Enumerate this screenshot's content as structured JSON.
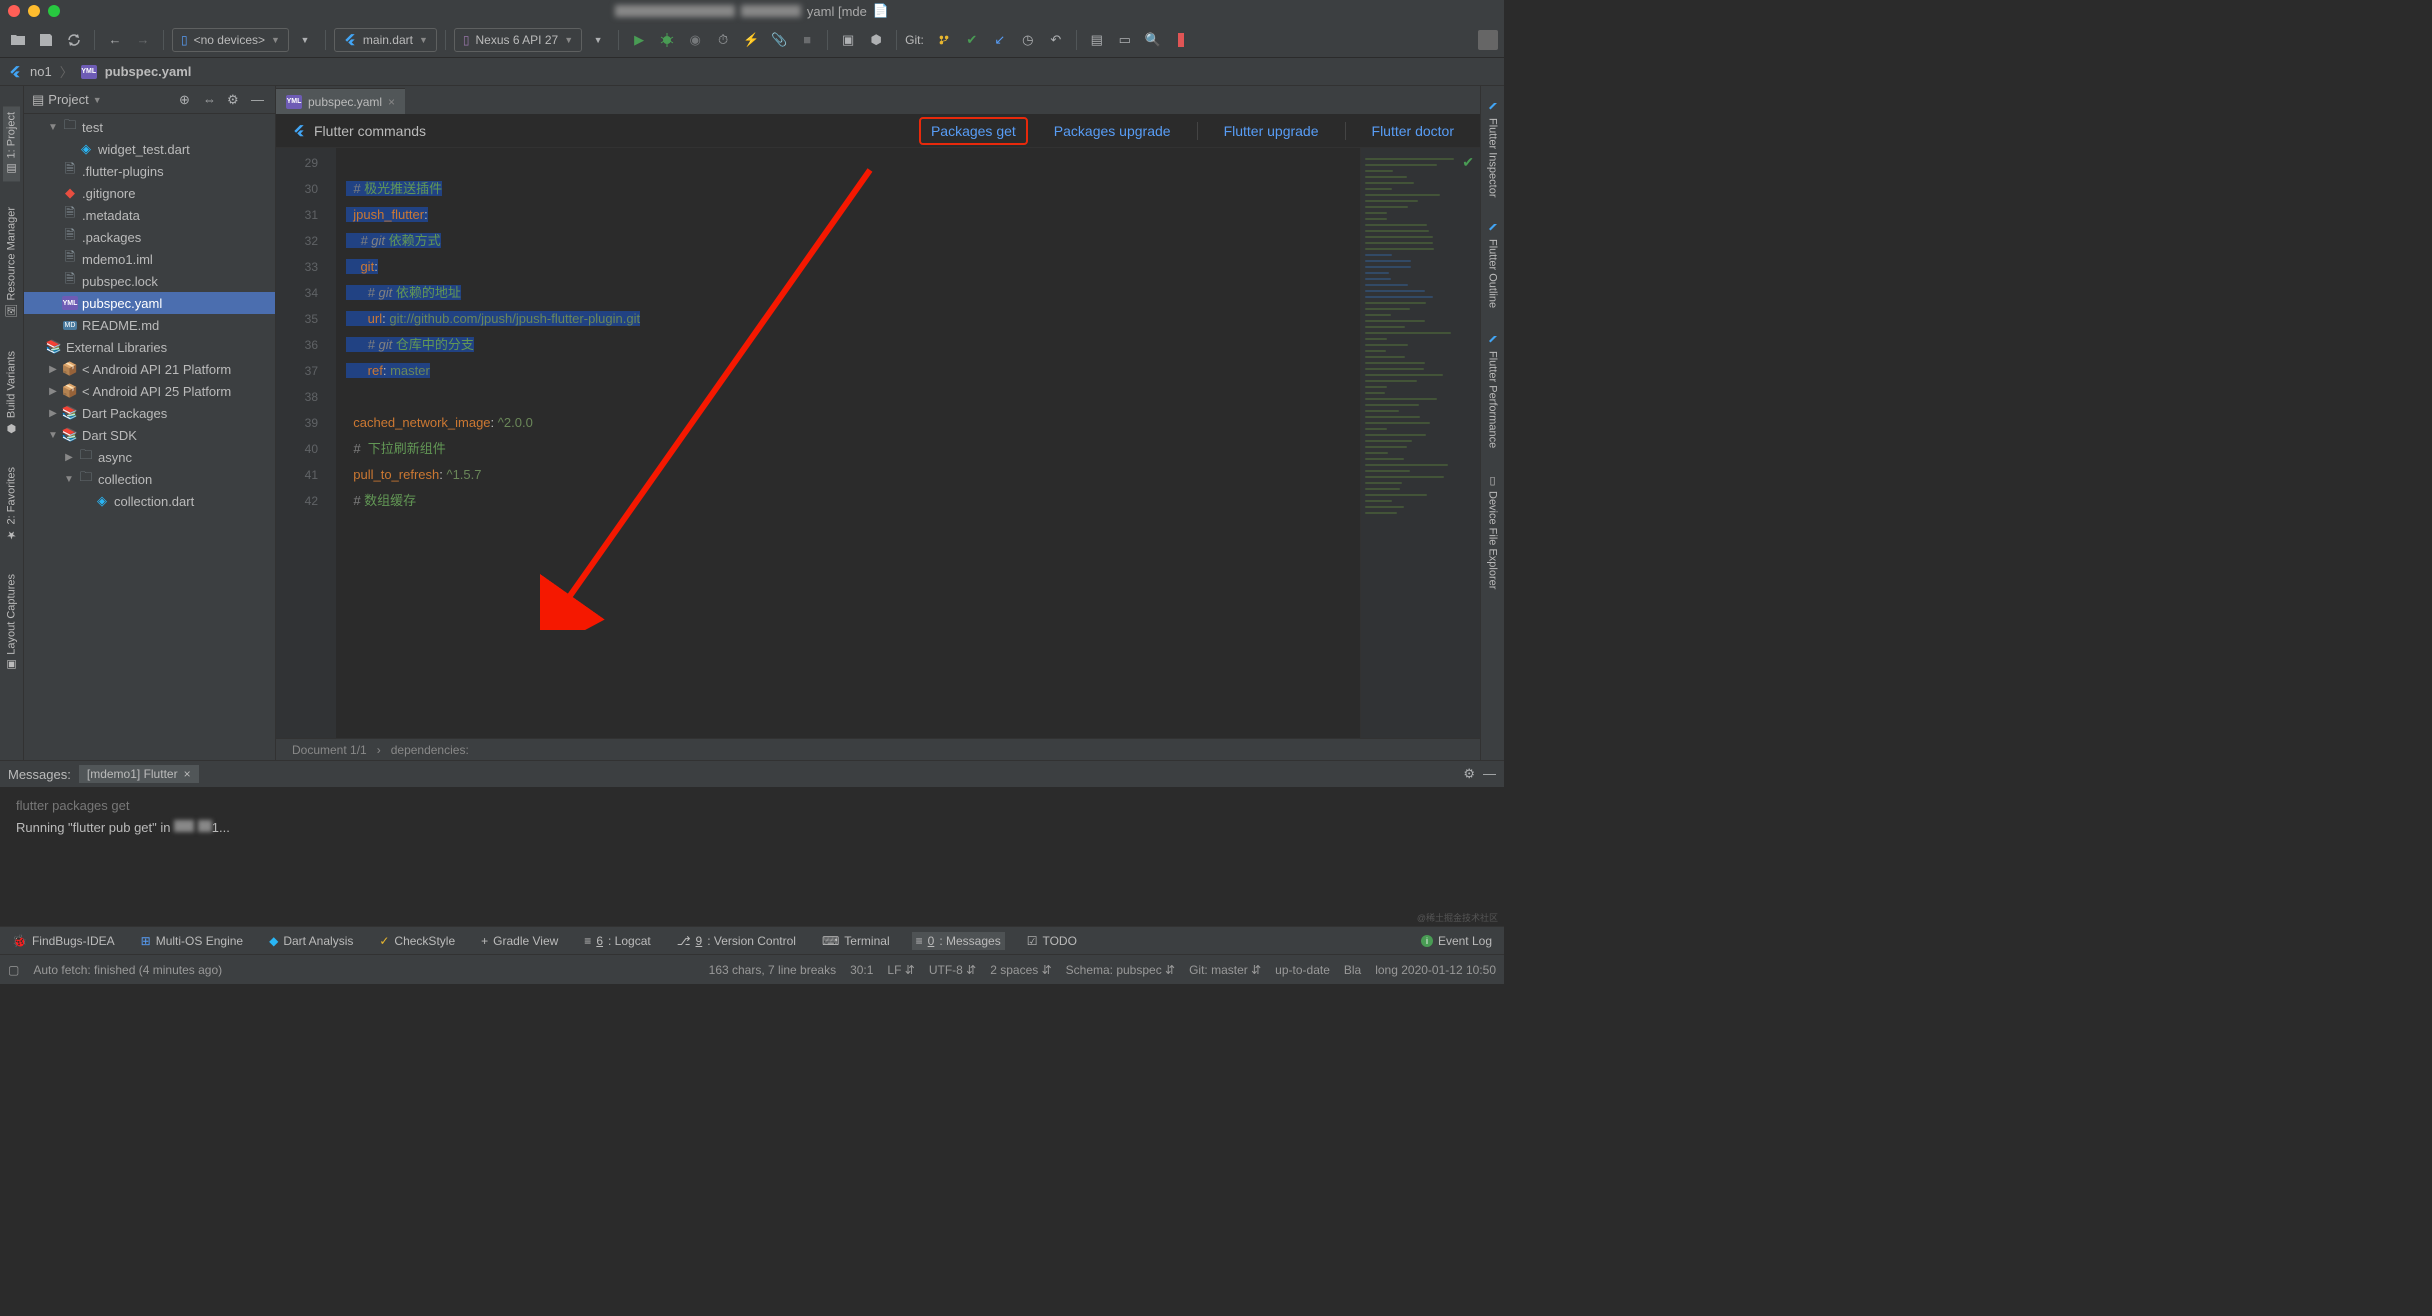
{
  "titlebar": {
    "suffix": "yaml [mde"
  },
  "toolbar": {
    "devices": "<no devices>",
    "runconfig": "main.dart",
    "emulator": "Nexus 6 API 27",
    "git_label": "Git:"
  },
  "breadcrumb": {
    "seg1": "no1",
    "seg2": "pubspec.yaml"
  },
  "left_tabs": {
    "project": "1: Project",
    "resource": "Resource Manager",
    "build": "Build Variants",
    "favorites": "2: Favorites",
    "captures": "Layout Captures"
  },
  "right_tabs": {
    "inspector": "Flutter Inspector",
    "outline": "Flutter Outline",
    "performance": "Flutter Performance",
    "device": "Device File Explorer"
  },
  "project": {
    "header": "Project",
    "tree": [
      {
        "d": 1,
        "exp": "▼",
        "icon": "folder",
        "label": "test"
      },
      {
        "d": 2,
        "exp": "",
        "icon": "dart",
        "label": "widget_test.dart"
      },
      {
        "d": 1,
        "exp": "",
        "icon": "file",
        "label": ".flutter-plugins"
      },
      {
        "d": 1,
        "exp": "",
        "icon": "gitign",
        "label": ".gitignore"
      },
      {
        "d": 1,
        "exp": "",
        "icon": "file",
        "label": ".metadata"
      },
      {
        "d": 1,
        "exp": "",
        "icon": "file",
        "label": ".packages"
      },
      {
        "d": 1,
        "exp": "",
        "icon": "file",
        "label": "mdemo1.iml"
      },
      {
        "d": 1,
        "exp": "",
        "icon": "file",
        "label": "pubspec.lock"
      },
      {
        "d": 1,
        "exp": "",
        "icon": "yaml",
        "label": "pubspec.yaml",
        "sel": true
      },
      {
        "d": 1,
        "exp": "",
        "icon": "md",
        "label": "README.md"
      },
      {
        "d": 0,
        "exp": "",
        "icon": "lib",
        "label": "External Libraries"
      },
      {
        "d": 1,
        "exp": "▶",
        "icon": "pkg",
        "label": "< Android API 21 Platform"
      },
      {
        "d": 1,
        "exp": "▶",
        "icon": "pkg",
        "label": "< Android API 25 Platform"
      },
      {
        "d": 1,
        "exp": "▶",
        "icon": "lib",
        "label": "Dart Packages"
      },
      {
        "d": 1,
        "exp": "▼",
        "icon": "lib",
        "label": "Dart SDK"
      },
      {
        "d": 2,
        "exp": "▶",
        "icon": "folder",
        "label": "async"
      },
      {
        "d": 2,
        "exp": "▼",
        "icon": "folder",
        "label": "collection"
      },
      {
        "d": 3,
        "exp": "",
        "icon": "dart",
        "label": "collection.dart"
      }
    ]
  },
  "editor": {
    "tab": "pubspec.yaml",
    "banner": {
      "title": "Flutter commands",
      "packages_get": "Packages get",
      "packages_upgrade": "Packages upgrade",
      "flutter_upgrade": "Flutter upgrade",
      "flutter_doctor": "Flutter doctor"
    },
    "gutter_start": 29,
    "lines": [
      {
        "n": 29,
        "html": ""
      },
      {
        "n": 30,
        "sel": true,
        "html": "<span class='cm'># </span><span class='cm-zh'>极光推送插件</span>"
      },
      {
        "n": 31,
        "sel": true,
        "html": "<span class='key'>jpush_flutter</span>:"
      },
      {
        "n": 32,
        "sel": true,
        "html": "  <span class='cm'># git </span><span class='cm-zh'>依赖方式</span>"
      },
      {
        "n": 33,
        "sel": true,
        "html": "  <span class='key'>git</span>:"
      },
      {
        "n": 34,
        "sel": true,
        "html": "    <span class='cm'># git </span><span class='cm-zh'>依赖的地址</span>"
      },
      {
        "n": 35,
        "sel": true,
        "html": "    <span class='key'>url</span>: <span class='str'>git://github.com/jpush/jpush-flutter-plugin.git</span>"
      },
      {
        "n": 36,
        "sel": true,
        "html": "    <span class='cm'># git </span><span class='cm-zh'>仓库中的分支</span>"
      },
      {
        "n": 37,
        "sel": true,
        "html": "    <span class='key'>ref</span>: <span class='str'>master</span>"
      },
      {
        "n": 38,
        "html": ""
      },
      {
        "n": 39,
        "html": "<span class='key'>cached_network_image</span>: <span class='str'>^2.0.0</span>"
      },
      {
        "n": 40,
        "html": "<span class='cm'>#  </span><span class='cm-zh'>下拉刷新组件</span>"
      },
      {
        "n": 41,
        "html": "<span class='key'>pull_to_refresh</span>: <span class='str'>^1.5.7</span>"
      },
      {
        "n": 42,
        "html": "<span class='cm'># </span><span class='cm-zh'>数组缓存</span>"
      }
    ],
    "status": {
      "doc": "Document 1/1",
      "path": "dependencies:"
    }
  },
  "messages": {
    "title": "Messages:",
    "tab": "[mdemo1] Flutter",
    "line1": "flutter packages get",
    "line2a": "Running \"flutter pub get\" in ",
    "line2b": "1..."
  },
  "bottom_tabs": {
    "findbugs": "FindBugs-IDEA",
    "multios": "Multi-OS Engine",
    "dart": "Dart Analysis",
    "checkstyle": "CheckStyle",
    "gradle": "Gradle View",
    "logcat_num": "6",
    "logcat": ": Logcat",
    "vcs_num": "9",
    "vcs": ": Version Control",
    "terminal": "Terminal",
    "messages_num": "0",
    "messages": ": Messages",
    "todo": "TODO",
    "eventlog": "Event Log"
  },
  "statusbar": {
    "autofetch": "Auto fetch: finished (4 minutes ago)",
    "chars": "163 chars, 7 line breaks",
    "pos": "30:1",
    "le": "LF",
    "enc": "UTF-8",
    "indent": "2 spaces",
    "schema": "Schema: pubspec",
    "git": "Git: master",
    "uptodate": "up-to-date",
    "bla": "Bla",
    "long": "long 2020-01-12 10:50"
  },
  "watermark": "@稀土掘金技术社区"
}
